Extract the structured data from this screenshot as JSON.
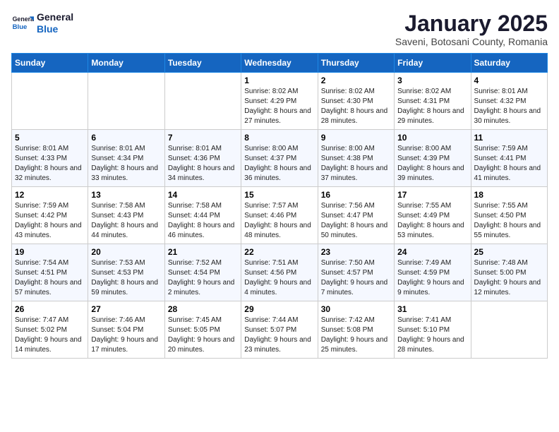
{
  "header": {
    "logo_general": "General",
    "logo_blue": "Blue",
    "title": "January 2025",
    "subtitle": "Saveni, Botosani County, Romania"
  },
  "weekdays": [
    "Sunday",
    "Monday",
    "Tuesday",
    "Wednesday",
    "Thursday",
    "Friday",
    "Saturday"
  ],
  "weeks": [
    [
      {
        "day": "",
        "info": ""
      },
      {
        "day": "",
        "info": ""
      },
      {
        "day": "",
        "info": ""
      },
      {
        "day": "1",
        "info": "Sunrise: 8:02 AM\nSunset: 4:29 PM\nDaylight: 8 hours and 27 minutes."
      },
      {
        "day": "2",
        "info": "Sunrise: 8:02 AM\nSunset: 4:30 PM\nDaylight: 8 hours and 28 minutes."
      },
      {
        "day": "3",
        "info": "Sunrise: 8:02 AM\nSunset: 4:31 PM\nDaylight: 8 hours and 29 minutes."
      },
      {
        "day": "4",
        "info": "Sunrise: 8:01 AM\nSunset: 4:32 PM\nDaylight: 8 hours and 30 minutes."
      }
    ],
    [
      {
        "day": "5",
        "info": "Sunrise: 8:01 AM\nSunset: 4:33 PM\nDaylight: 8 hours and 32 minutes."
      },
      {
        "day": "6",
        "info": "Sunrise: 8:01 AM\nSunset: 4:34 PM\nDaylight: 8 hours and 33 minutes."
      },
      {
        "day": "7",
        "info": "Sunrise: 8:01 AM\nSunset: 4:36 PM\nDaylight: 8 hours and 34 minutes."
      },
      {
        "day": "8",
        "info": "Sunrise: 8:00 AM\nSunset: 4:37 PM\nDaylight: 8 hours and 36 minutes."
      },
      {
        "day": "9",
        "info": "Sunrise: 8:00 AM\nSunset: 4:38 PM\nDaylight: 8 hours and 37 minutes."
      },
      {
        "day": "10",
        "info": "Sunrise: 8:00 AM\nSunset: 4:39 PM\nDaylight: 8 hours and 39 minutes."
      },
      {
        "day": "11",
        "info": "Sunrise: 7:59 AM\nSunset: 4:41 PM\nDaylight: 8 hours and 41 minutes."
      }
    ],
    [
      {
        "day": "12",
        "info": "Sunrise: 7:59 AM\nSunset: 4:42 PM\nDaylight: 8 hours and 43 minutes."
      },
      {
        "day": "13",
        "info": "Sunrise: 7:58 AM\nSunset: 4:43 PM\nDaylight: 8 hours and 44 minutes."
      },
      {
        "day": "14",
        "info": "Sunrise: 7:58 AM\nSunset: 4:44 PM\nDaylight: 8 hours and 46 minutes."
      },
      {
        "day": "15",
        "info": "Sunrise: 7:57 AM\nSunset: 4:46 PM\nDaylight: 8 hours and 48 minutes."
      },
      {
        "day": "16",
        "info": "Sunrise: 7:56 AM\nSunset: 4:47 PM\nDaylight: 8 hours and 50 minutes."
      },
      {
        "day": "17",
        "info": "Sunrise: 7:55 AM\nSunset: 4:49 PM\nDaylight: 8 hours and 53 minutes."
      },
      {
        "day": "18",
        "info": "Sunrise: 7:55 AM\nSunset: 4:50 PM\nDaylight: 8 hours and 55 minutes."
      }
    ],
    [
      {
        "day": "19",
        "info": "Sunrise: 7:54 AM\nSunset: 4:51 PM\nDaylight: 8 hours and 57 minutes."
      },
      {
        "day": "20",
        "info": "Sunrise: 7:53 AM\nSunset: 4:53 PM\nDaylight: 8 hours and 59 minutes."
      },
      {
        "day": "21",
        "info": "Sunrise: 7:52 AM\nSunset: 4:54 PM\nDaylight: 9 hours and 2 minutes."
      },
      {
        "day": "22",
        "info": "Sunrise: 7:51 AM\nSunset: 4:56 PM\nDaylight: 9 hours and 4 minutes."
      },
      {
        "day": "23",
        "info": "Sunrise: 7:50 AM\nSunset: 4:57 PM\nDaylight: 9 hours and 7 minutes."
      },
      {
        "day": "24",
        "info": "Sunrise: 7:49 AM\nSunset: 4:59 PM\nDaylight: 9 hours and 9 minutes."
      },
      {
        "day": "25",
        "info": "Sunrise: 7:48 AM\nSunset: 5:00 PM\nDaylight: 9 hours and 12 minutes."
      }
    ],
    [
      {
        "day": "26",
        "info": "Sunrise: 7:47 AM\nSunset: 5:02 PM\nDaylight: 9 hours and 14 minutes."
      },
      {
        "day": "27",
        "info": "Sunrise: 7:46 AM\nSunset: 5:04 PM\nDaylight: 9 hours and 17 minutes."
      },
      {
        "day": "28",
        "info": "Sunrise: 7:45 AM\nSunset: 5:05 PM\nDaylight: 9 hours and 20 minutes."
      },
      {
        "day": "29",
        "info": "Sunrise: 7:44 AM\nSunset: 5:07 PM\nDaylight: 9 hours and 23 minutes."
      },
      {
        "day": "30",
        "info": "Sunrise: 7:42 AM\nSunset: 5:08 PM\nDaylight: 9 hours and 25 minutes."
      },
      {
        "day": "31",
        "info": "Sunrise: 7:41 AM\nSunset: 5:10 PM\nDaylight: 9 hours and 28 minutes."
      },
      {
        "day": "",
        "info": ""
      }
    ]
  ]
}
